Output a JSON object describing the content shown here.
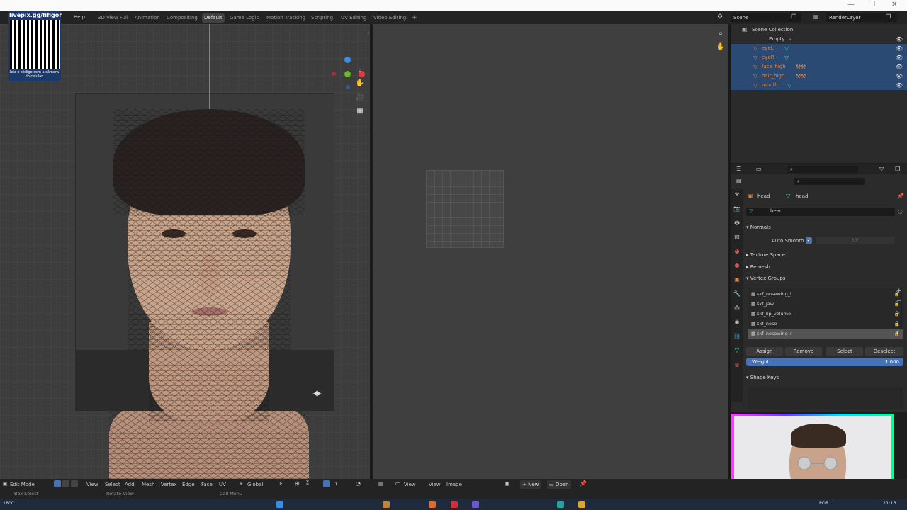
{
  "titlebar": {
    "minimize": "—",
    "maximize": "❐",
    "close": "✕"
  },
  "topbar": {
    "menu_help": "Help",
    "workspaces": [
      "3D View Full",
      "Animation",
      "Compositing",
      "Default",
      "Game Logic",
      "Motion Tracking",
      "Scripting",
      "UV Editing",
      "Video Editing"
    ],
    "active_workspace": "Default",
    "add_tab": "+",
    "scene_label": "Scene",
    "renderlayer_label": "RenderLayer"
  },
  "qr": {
    "title": "livepix.gg/fifigor",
    "caption": "leia o código com a câmera do celular."
  },
  "outliner": {
    "title": "Scene Collection",
    "items": [
      {
        "label": "Empty",
        "selected": false,
        "color": "#d8d8d8"
      },
      {
        "label": "eyeL",
        "selected": true,
        "color": "#e0833f"
      },
      {
        "label": "eyeR",
        "selected": true,
        "color": "#e0833f"
      },
      {
        "label": "face_high",
        "selected": true,
        "color": "#e0833f"
      },
      {
        "label": "hair_high",
        "selected": true,
        "color": "#e0833f"
      },
      {
        "label": "mouth",
        "selected": true,
        "color": "#e0833f"
      }
    ]
  },
  "properties": {
    "object_name": "head",
    "mesh_name": "head",
    "data_name": "head",
    "panels": {
      "normals": "Normals",
      "auto_smooth": "Auto Smooth",
      "auto_smooth_angle": "30°",
      "texture_space": "Texture Space",
      "remesh": "Remesh",
      "vertex_groups": "Vertex Groups",
      "shape_keys": "Shape Keys"
    },
    "vertex_groups": [
      {
        "name": "skf_nosewing_l",
        "active": false
      },
      {
        "name": "skf_jaw",
        "active": false
      },
      {
        "name": "skf_lip_volume",
        "active": false
      },
      {
        "name": "skf_nose",
        "active": false
      },
      {
        "name": "skf_nosewing_r",
        "active": true
      }
    ],
    "buttons": {
      "assign": "Assign",
      "remove": "Remove",
      "select": "Select",
      "deselect": "Deselect"
    },
    "weight_label": "Weight",
    "weight_value": "1.000"
  },
  "bottombar": {
    "mode": "Edit Mode",
    "menus": [
      "View",
      "Select",
      "Add",
      "Mesh",
      "Vertex",
      "Edge",
      "Face",
      "UV"
    ],
    "orientation": "Global",
    "ie_menus": [
      "View",
      "View",
      "Image"
    ],
    "new_button": "New",
    "open_button": "Open"
  },
  "statusbar": {
    "box_select": "Box Select",
    "rotate_view": "Rotate View",
    "call_menu": "Call Menu"
  },
  "taskbar": {
    "temp": "18°C",
    "lang": "POR",
    "time": "21:13"
  },
  "colors": {
    "accent": "#4772b3",
    "selection": "#2a4a73",
    "orange": "#e0833f"
  }
}
